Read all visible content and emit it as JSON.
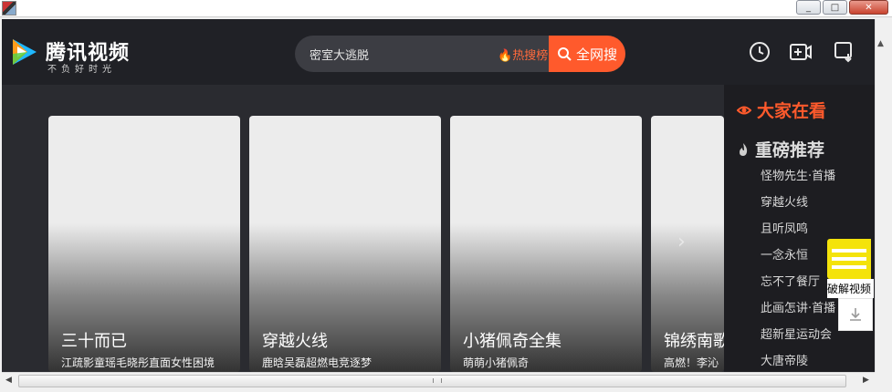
{
  "window": {
    "minimize": "_",
    "maximize": "□",
    "close": "✕"
  },
  "brand": {
    "name": "腾讯视频",
    "slogan": "不负好时光"
  },
  "search": {
    "query": "密室大逃脱",
    "hot_label": "热搜榜",
    "button": "全网搜"
  },
  "header_icons": [
    "history-icon",
    "upload-video-icon",
    "download-screen-icon"
  ],
  "cards": [
    {
      "title": "三十而已",
      "subtitle": "江疏影童瑶毛晓彤直面女性困境"
    },
    {
      "title": "穿越火线",
      "subtitle": "鹿晗吴磊超燃电竞逐梦"
    },
    {
      "title": "小猪佩奇全集",
      "subtitle": "萌萌小猪佩奇"
    },
    {
      "title": "锦绣南歌",
      "subtitle": "高燃！李沁"
    }
  ],
  "next_glyph": "›",
  "panel": {
    "heading_watching": "大家在看",
    "heading_recommend": "重磅推荐",
    "items": [
      "怪物先生·首播",
      "穿越火线",
      "且听凤鸣",
      "一念永恒",
      "忘不了餐厅",
      "此画怎讲·首播",
      "超新星运动会",
      "大唐帝陵"
    ]
  },
  "float_tool": {
    "label": "破解视频"
  },
  "colors": {
    "accent": "#ff5a2c",
    "header_bg": "#202126",
    "panel_bg": "#1d1d21",
    "float": "#f4e30b"
  }
}
